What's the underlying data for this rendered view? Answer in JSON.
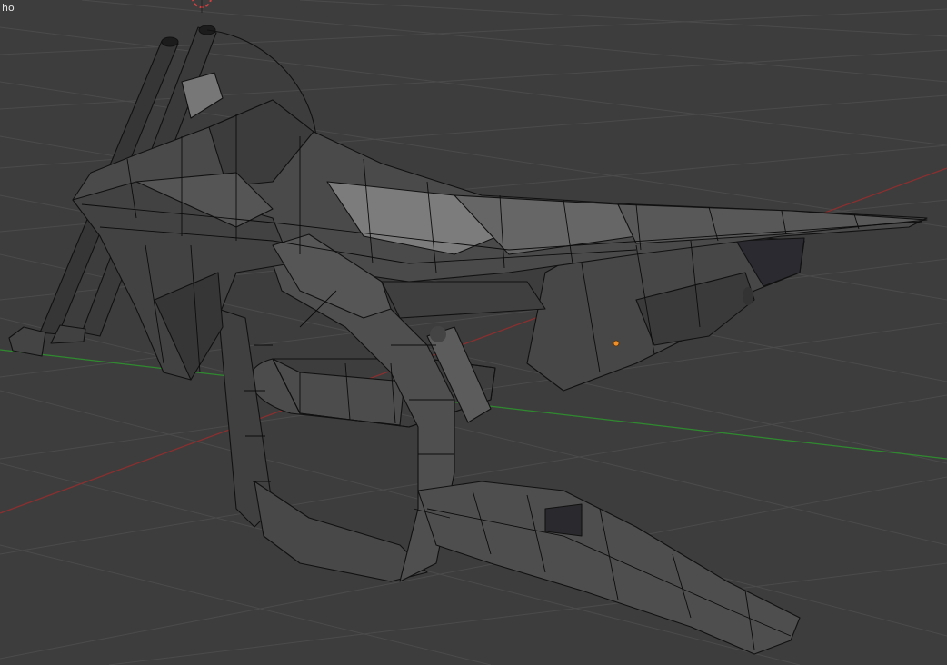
{
  "viewport": {
    "overlay_text": "ho",
    "colors": {
      "background": "#3d3d3d",
      "grid_line": "#4b4b4b",
      "x_axis": "#8a2f2f",
      "y_axis": "#2f8a2f",
      "mesh_dark": "#2e2e2e",
      "mesh_mid": "#4a4a4a",
      "mesh_light": "#7c7c7c",
      "mesh_edge": "#111111",
      "origin_dot": "#f0902a",
      "cursor": "#d04040"
    }
  }
}
